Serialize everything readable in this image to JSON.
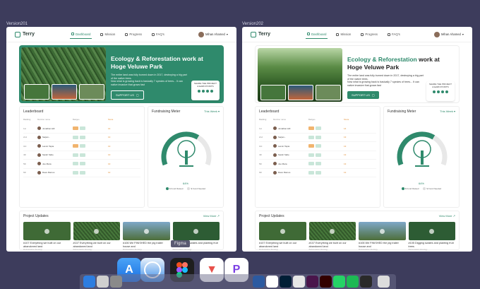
{
  "versions": [
    "Version201",
    "Version202"
  ],
  "app": {
    "logo": "Terry",
    "nav": [
      "Dashboard",
      "Mission",
      "Progress",
      "FAQ's"
    ],
    "user": "Mihan Ahamed"
  },
  "hero": {
    "title_accent": "Ecology & Reforestation",
    "title_rest": " work at Hoge Veluwe Park",
    "desc1": "The entire land was fully burned down in 2017, destroying a big part of the native trees.",
    "desc2": "Now what is growing back is basically 7 species of trees... It can native invasive that grows fast",
    "support": "SUPPORT US",
    "share": "SHARE THE PROJECT & EARN POINTS"
  },
  "leaderboard": {
    "title": "Leaderboard",
    "headers": [
      "Ranking",
      "Member name",
      "Badges",
      "Score"
    ],
    "rows": [
      {
        "rank": "1st",
        "name": "Jonathan Hill",
        "score": "14"
      },
      {
        "rank": "2nd",
        "name": "Sarjan...",
        "score": "13"
      },
      {
        "rank": "3rd",
        "name": "Lamin Tapia",
        "score": "13"
      },
      {
        "rank": "4th",
        "name": "Sarah Sahe",
        "score": "13"
      },
      {
        "rank": "5th",
        "name": "Joe Mara",
        "score": "13"
      },
      {
        "rank": "6th",
        "name": "Dave Ramos",
        "score": "12"
      }
    ]
  },
  "fundraising": {
    "title": "Fundraising Meter",
    "more": "This Week",
    "percent": "64%",
    "legend": [
      "$ Fund Raised",
      "$ Fund Needed"
    ],
    "fill": 0.64
  },
  "updates": {
    "title": "Project Updates",
    "more": "View More",
    "cards": [
      {
        "text": "#107 Everything we built on our abandoned land",
        "tags": "#reforestation #ecology"
      },
      {
        "text": "#107 Everything we built on our abandoned land",
        "tags": "#reforestation #ecology"
      },
      {
        "text": "#106 We FINISHED the pig trailer house and",
        "tags": "#reforestation #ecology"
      },
      {
        "text": "#105 Digging swales and planting fruit trees",
        "tags": "#reforestation #ecology"
      }
    ]
  },
  "dock": {
    "tooltip": "Figma"
  },
  "colors": {
    "accent": "#2f8a6c",
    "background": "#3d3c5c"
  }
}
